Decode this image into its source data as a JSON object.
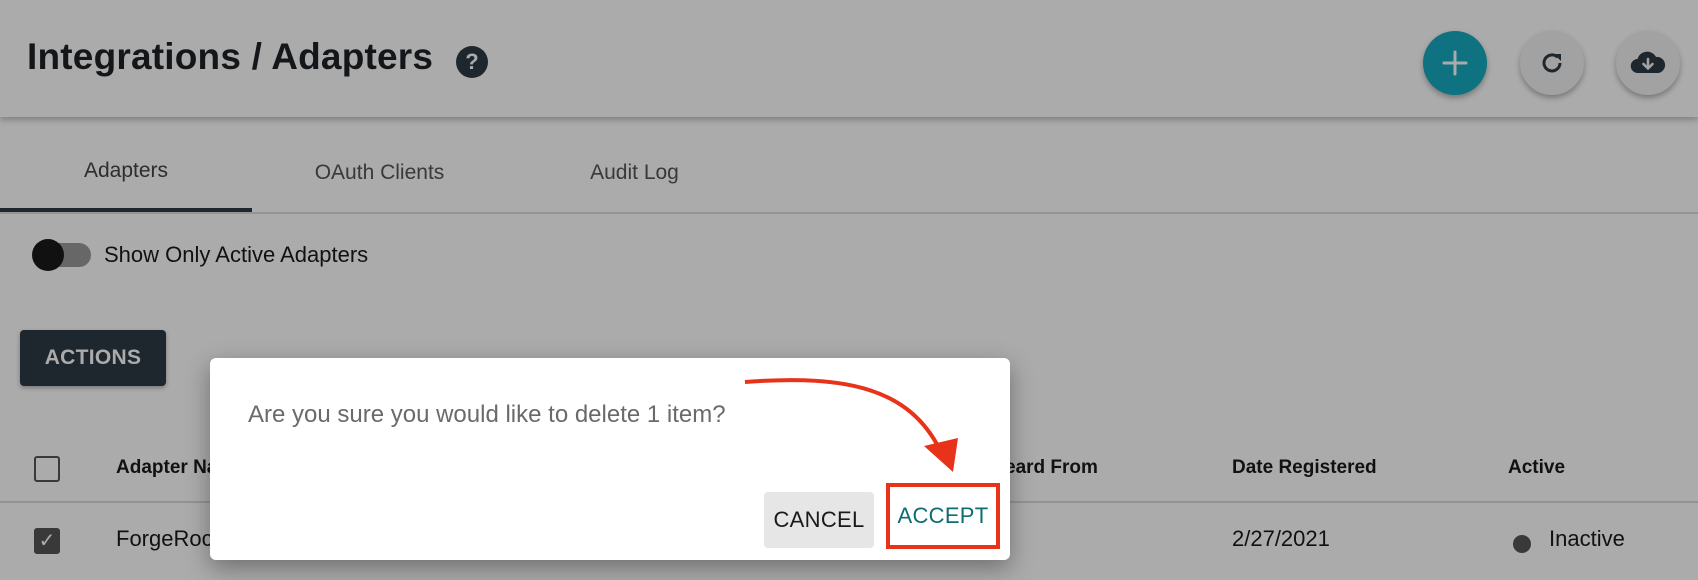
{
  "header": {
    "title": "Integrations / Adapters",
    "help_icon": "help-circle-icon",
    "actions": [
      {
        "name": "add",
        "icon": "plus-icon",
        "color": "#17aabf"
      },
      {
        "name": "refresh",
        "icon": "refresh-icon"
      },
      {
        "name": "download",
        "icon": "cloud-download-icon"
      }
    ]
  },
  "tabs": [
    {
      "label": "Adapters",
      "active": true
    },
    {
      "label": "OAuth Clients",
      "active": false
    },
    {
      "label": "Audit Log",
      "active": false
    }
  ],
  "filter": {
    "toggle_label": "Show Only Active Adapters",
    "toggle_on": false
  },
  "toolbar": {
    "actions_label": "ACTIONS"
  },
  "table": {
    "columns": [
      "Adapter Na",
      "eard From",
      "Date Registered",
      "Active"
    ],
    "rows": [
      {
        "checked": true,
        "name": "ForgeRoc",
        "date_registered": "2/27/2021",
        "active": "Inactive"
      }
    ]
  },
  "dialog": {
    "message": "Are you sure you would like to delete 1 item?",
    "cancel_label": "CANCEL",
    "accept_label": "ACCEPT",
    "accept_highlight_color": "#e8321a"
  }
}
